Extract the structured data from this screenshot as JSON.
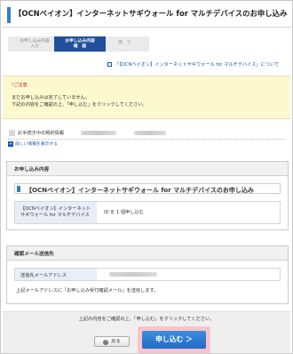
{
  "header": {
    "title": "【OCNベイオン】インターネットサギウォール for マルチデバイスのお申し込み"
  },
  "steps": [
    {
      "line1": "お申し込み内容",
      "line2": "入力"
    },
    {
      "line1": "お申し込み内容",
      "line2": "確　認"
    },
    {
      "line1": "完　了",
      "line2": ""
    }
  ],
  "campaign_link": "「【OCNベイオン】インターネットサギウォール for マルチデバイス」について",
  "notice": {
    "heading": "ご注意",
    "line1": "まだお申し込みは完了していません。",
    "line2": "下記の内容をご確認の上、「申し込む」をクリックしてください。"
  },
  "contract": {
    "label": "お手続き中の契約情報",
    "more_link": "詳しい情報を表示する"
  },
  "application": {
    "section_title": "お申し込み内容",
    "product_title": "【OCNベイオン】インターネットサギウォール for マルチデバイスのお申し込み",
    "row_key_line1": "【OCNベイオン】インターネット",
    "row_key_line2": "サギウォール for マルチデバイス",
    "row_value": "ID を 1 個申し込む"
  },
  "confirmation": {
    "section_title": "確認メール送信先",
    "row_key": "送信先メールアドレス",
    "note": "上記メールアドレスに「お申し込み受付確認メール」を送信します。"
  },
  "footer": {
    "message": "上記の内容をご確認の上、「申し込む」をクリックしてください。",
    "back_label": "戻る",
    "apply_label": "申し込む ＞"
  },
  "colors": {
    "accent": "#1f6bc4",
    "notice_bg": "#fdf9cf",
    "warning": "#d0122a",
    "active_step": "#1f4f9a"
  }
}
